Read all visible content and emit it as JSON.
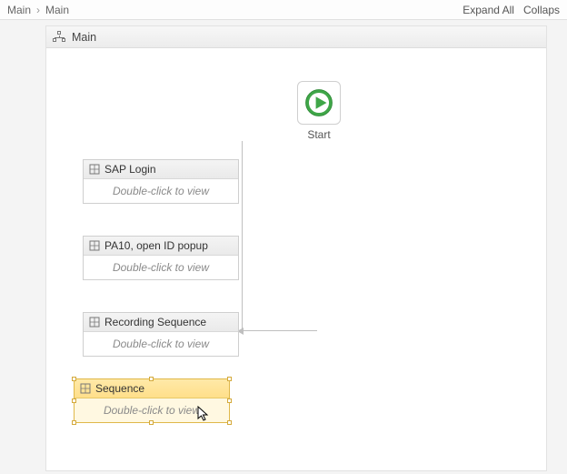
{
  "breadcrumbs": {
    "root": "Main",
    "current": "Main",
    "sep": "›"
  },
  "toolbar": {
    "expand": "Expand All",
    "collapse": "Collaps"
  },
  "panel": {
    "title": "Main"
  },
  "start": {
    "label": "Start"
  },
  "activities": [
    {
      "title": "SAP Login",
      "hint": "Double-click to view"
    },
    {
      "title": "PA10, open ID popup",
      "hint": "Double-click to view"
    },
    {
      "title": "Recording Sequence",
      "hint": "Double-click to view"
    },
    {
      "title": "Sequence",
      "hint": "Double-click to view"
    }
  ]
}
